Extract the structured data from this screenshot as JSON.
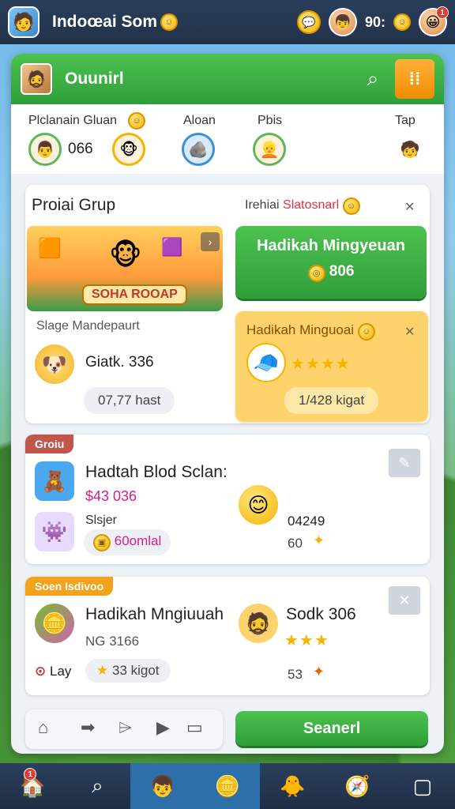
{
  "topbar": {
    "title": "Indoœai Som",
    "count": "90:",
    "badge": "1"
  },
  "header": {
    "title": "Ouunirl"
  },
  "friends": {
    "labels": [
      "Plclanain Gluan",
      "Aloan",
      "Pbis",
      "Tap"
    ],
    "count": "066"
  },
  "group": {
    "title": "Proiai Grup",
    "promo": "Irehiai",
    "promo_red": "Slatosnarl",
    "banner_title": "SOHA ROOAP",
    "stage_label": "Slage Mandepaurt",
    "stage_value": "Giatk. 336",
    "stage_chip": "07,77 hast"
  },
  "reward_button": {
    "title": "Hadikah Mingyeuan",
    "amount": "806"
  },
  "weekly": {
    "title": "Hadikah Minguoai",
    "chip": "1/428 kigat",
    "rating": 4
  },
  "card1": {
    "tag": "Groiu",
    "title": "Hadtah Blod Sclan:",
    "price": "$43 036",
    "label": "Slsjer",
    "chip": "60omlal",
    "right_value": "04249",
    "right_small": "60"
  },
  "card2": {
    "tag": "Soen Isdivoo",
    "title": "Hadikah Mngiuuah",
    "sub": "NG 3166",
    "left_label": "Lay",
    "chip": "33 kigot",
    "right_title": "Sodk 306",
    "right_small": "53",
    "rating": 3
  },
  "actions": {
    "confirm": "Seanerl"
  },
  "colors": {
    "green": "#3cae44",
    "orange": "#f7a826",
    "navy": "#22324a",
    "promo_red": "#e0323a",
    "price_pink": "#d61e8a",
    "tag_red": "#c0574a",
    "tag_orange": "#f2a31b"
  }
}
